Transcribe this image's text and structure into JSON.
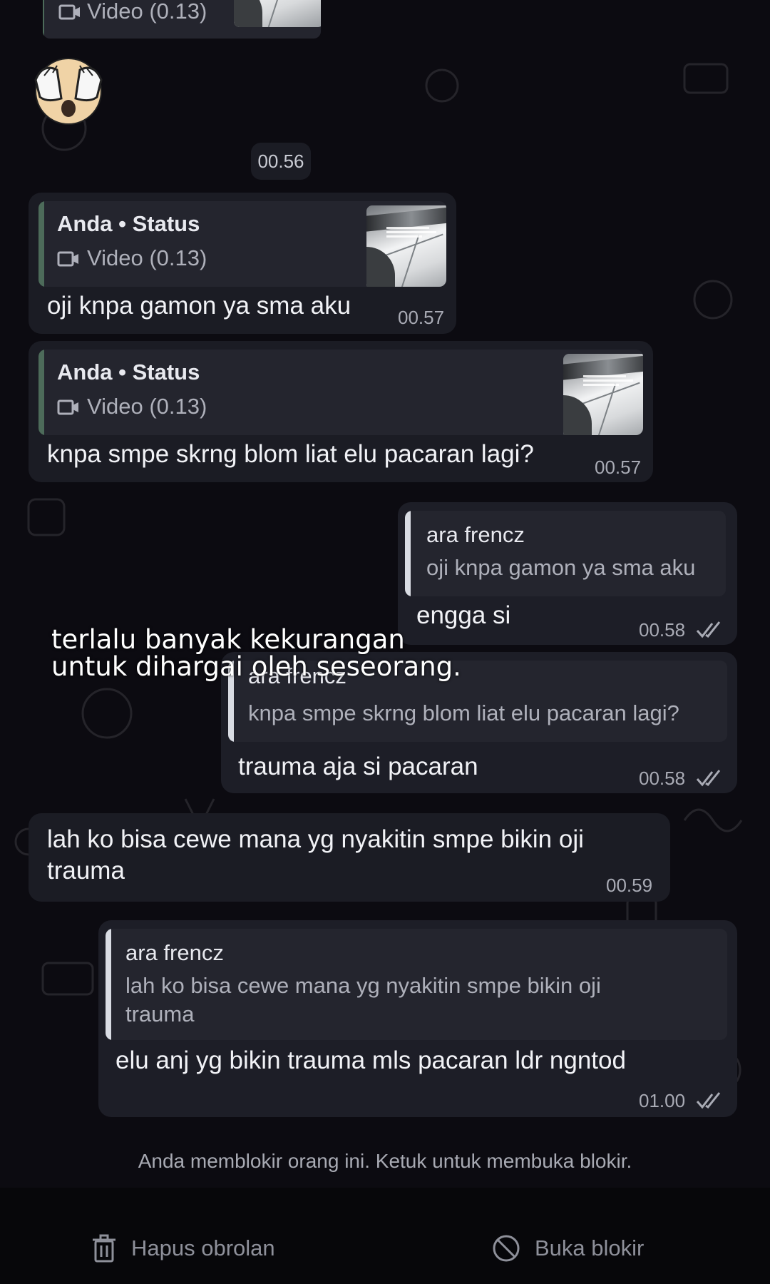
{
  "top_partial": {
    "quote_sub": "Video (0.13)"
  },
  "date_chip": "00.56",
  "messages": [
    {
      "quote_title": "Anda • Status",
      "quote_sub": "Video (0.13)",
      "text": "oji knpa gamon ya sma aku",
      "time": "00.57"
    },
    {
      "quote_title": "Anda • Status",
      "quote_sub": "Video (0.13)",
      "text": "knpa smpe skrng blom liat elu pacaran lagi?",
      "time": "00.57"
    },
    {
      "quote_title": "ara frencz",
      "quote_sub": "oji knpa gamon ya sma aku",
      "text": "engga si",
      "time": "00.58"
    },
    {
      "quote_title": "ara frencz",
      "quote_sub": "knpa smpe skrng blom liat elu pacaran lagi?",
      "text": "trauma aja si pacaran",
      "time": "00.58"
    },
    {
      "text_line1": "lah ko bisa cewe mana yg nyakitin smpe bikin oji",
      "text_line2": "trauma",
      "time": "00.59"
    },
    {
      "quote_title": "ara frencz",
      "quote_sub_line1": "lah ko bisa cewe mana yg nyakitin smpe bikin oji",
      "quote_sub_line2": "trauma",
      "text": "elu anj yg bikin trauma mls pacaran ldr ngntod",
      "time": "01.00"
    }
  ],
  "overlay_caption": {
    "line1": "terlalu banyak kekurangan",
    "line2": "untuk dihargai oleh seseorang."
  },
  "blocked_note": "Anda memblokir orang ini. Ketuk untuk membuka blokir.",
  "bottom_actions": {
    "delete_label": "Hapus obrolan",
    "unblock_label": "Buka blokir"
  },
  "icons": [
    "video-icon",
    "emoji-see-no-evil-icon",
    "double-check-icon",
    "trash-icon",
    "block-icon"
  ],
  "colors": {
    "background": "#0c0b11",
    "bubble": "#1b1c24",
    "quote_bar_green": "#4d6b5a"
  }
}
